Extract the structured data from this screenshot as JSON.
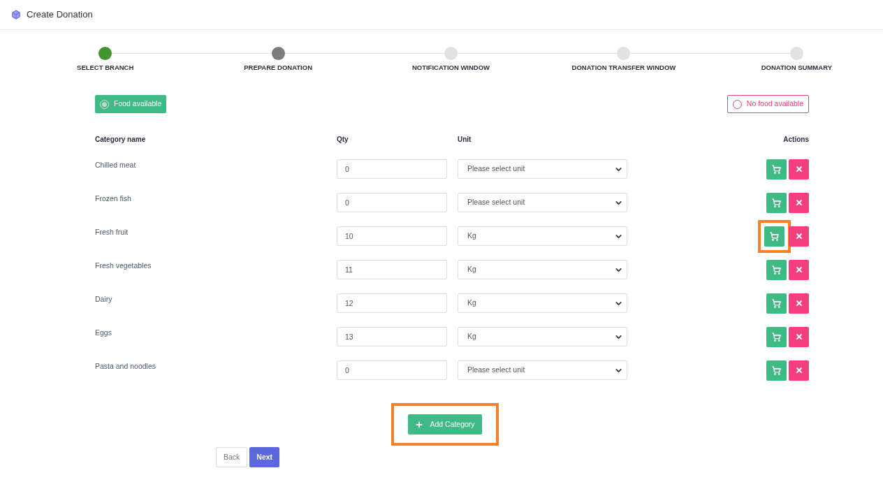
{
  "header": {
    "title": "Create Donation"
  },
  "steps": [
    {
      "label": "SELECT BRANCH",
      "completed": true,
      "current": false
    },
    {
      "label": "PREPARE DONATION",
      "completed": false,
      "current": true
    },
    {
      "label": "NOTIFICATION WINDOW",
      "completed": false,
      "current": false
    },
    {
      "label": "DONATION TRANSFER WINDOW",
      "completed": false,
      "current": false
    },
    {
      "label": "DONATION SUMMARY",
      "completed": false,
      "current": false
    }
  ],
  "availability": [
    {
      "label": "Food available",
      "selected": true
    },
    {
      "label": "No food available",
      "selected": false
    }
  ],
  "table": {
    "columns": [
      "Category name",
      "Qty",
      "Unit",
      "Actions"
    ],
    "rows": [
      {
        "name": "Chilled meat",
        "qty": "0",
        "unit": "Please select unit",
        "highlighted": false
      },
      {
        "name": "Frozen fish",
        "qty": "0",
        "unit": "Please select unit",
        "highlighted": false
      },
      {
        "name": "Fresh fruit",
        "qty": "10",
        "unit": "Kg",
        "highlighted": true
      },
      {
        "name": "Fresh vegetables",
        "qty": "11",
        "unit": "Kg",
        "highlighted": false
      },
      {
        "name": "Dairy",
        "qty": "12",
        "unit": "Kg",
        "highlighted": false
      },
      {
        "name": "Eggs",
        "qty": "13",
        "unit": "Kg",
        "highlighted": false
      },
      {
        "name": "Pasta and noodles",
        "qty": "0",
        "unit": "Please select unit",
        "highlighted": false
      }
    ]
  },
  "add_category": {
    "label": "Add Category",
    "highlighted": true
  },
  "buttons": {
    "back": "Back",
    "next": "Next"
  }
}
